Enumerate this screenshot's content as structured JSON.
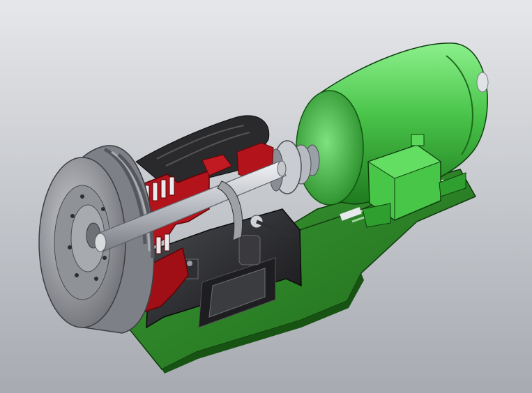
{
  "viewport": {
    "background_top": "#e6e7ea",
    "background_bottom": "#a7abb1"
  },
  "model": {
    "components": [
      "base-plate",
      "electric-motor",
      "coupling",
      "main-shaft",
      "gearbox-housing",
      "cutaway-clutch",
      "multi-groove-pulley"
    ],
    "colors": {
      "base_plate": "#2f8a2a",
      "motor": "#4fd04f",
      "cutaway_section": "#b3131b",
      "housing": "#2b2b2e",
      "pulley": "#8d8f95",
      "shaft": "#cfd2d6"
    }
  }
}
